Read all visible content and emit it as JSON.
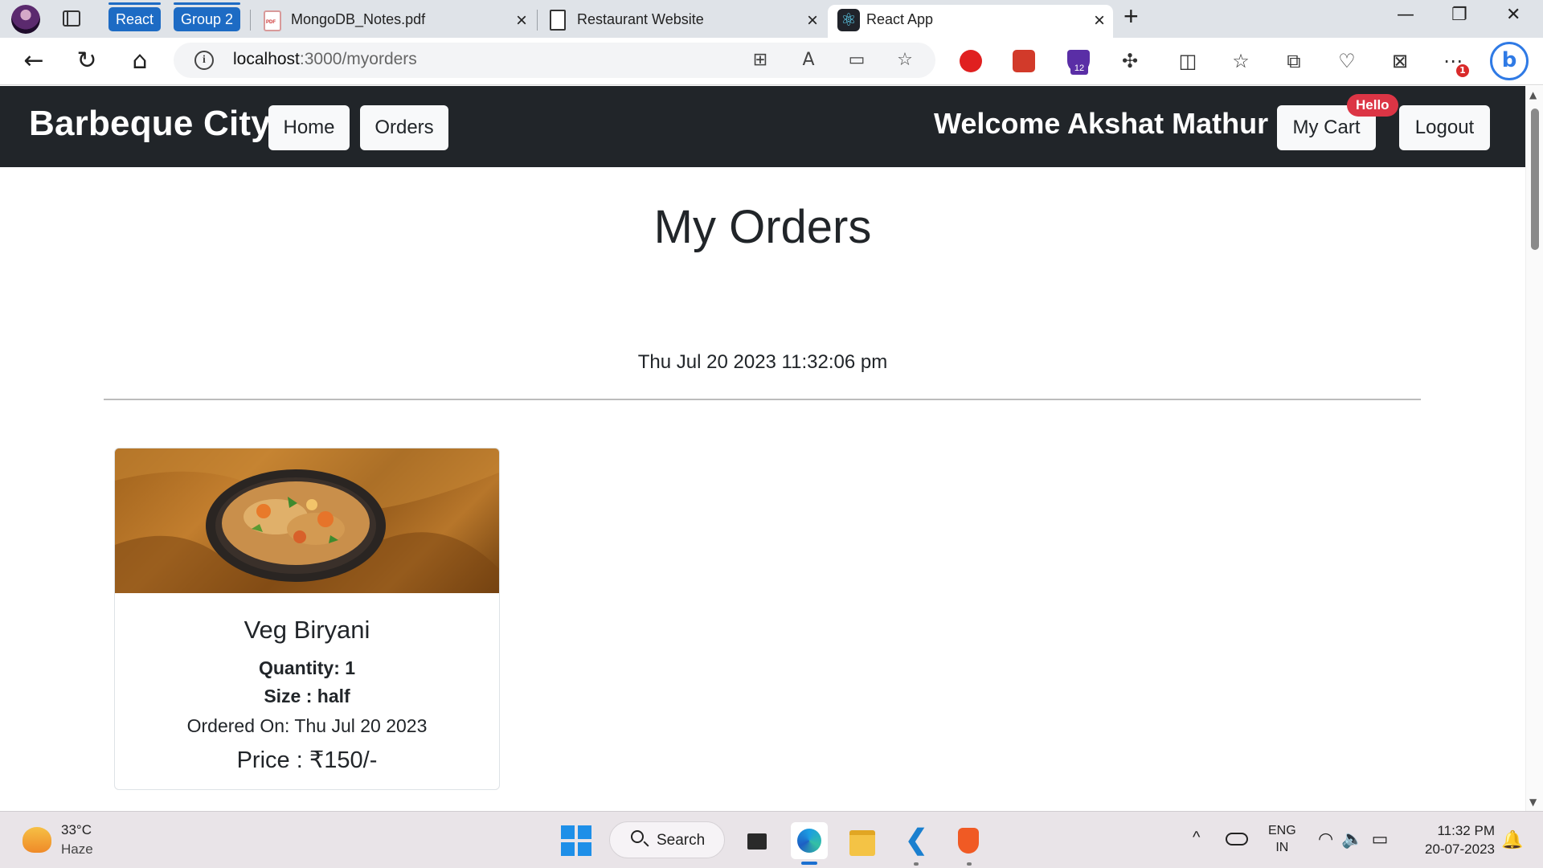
{
  "browser": {
    "tab_groups": [
      "React",
      "Group 2"
    ],
    "tabs": [
      {
        "title": "MongoDB_Notes.pdf",
        "icon": "pdf-icon"
      },
      {
        "title": "Restaurant Website",
        "icon": "page-icon"
      },
      {
        "title": "React App",
        "icon": "react-icon",
        "active": true
      }
    ],
    "url_host": "localhost",
    "url_path": ":3000/myorders",
    "extension_badge": "12",
    "notification_badge": "1"
  },
  "site": {
    "brand": "Barbeque City",
    "nav": [
      "Home",
      "Orders"
    ],
    "welcome": "Welcome Akshat Mathur",
    "cart_label": "My Cart",
    "cart_badge": "Hello",
    "logout_label": "Logout",
    "colors": {
      "navbar": "#212529",
      "badge": "#dc3545",
      "button": "#f8f9fa"
    }
  },
  "main": {
    "title": "My Orders",
    "order_date": "Thu Jul 20 2023 11:32:06 pm",
    "orders": [
      {
        "name": "Veg Biryani",
        "quantity": "Quantity: 1",
        "size": "Size : half",
        "ordered_on": "Ordered On: Thu Jul 20 2023",
        "price": "Price : ₹150/-",
        "image": "biryani-image"
      }
    ]
  },
  "taskbar": {
    "weather_temp": "33°C",
    "weather_desc": "Haze",
    "search_label": "Search",
    "lang_line1": "ENG",
    "lang_line2": "IN",
    "time": "11:32 PM",
    "date": "20-07-2023"
  }
}
